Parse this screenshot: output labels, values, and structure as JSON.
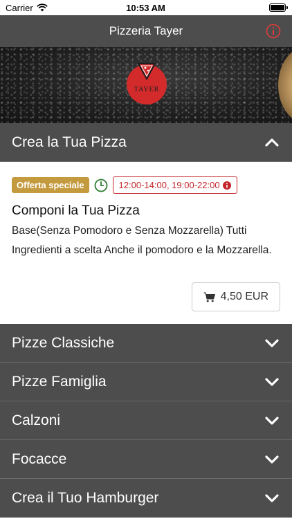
{
  "status_bar": {
    "carrier": "Carrier",
    "time": "10:53 AM"
  },
  "navbar": {
    "title": "Pizzeria Tayer"
  },
  "banner": {
    "logo_text": "TAYER"
  },
  "sections": [
    {
      "title": "Crea la Tua Pizza",
      "expanded": true
    },
    {
      "title": "Pizze Classiche",
      "expanded": false
    },
    {
      "title": "Pizze Famiglia",
      "expanded": false
    },
    {
      "title": "Calzoni",
      "expanded": false
    },
    {
      "title": "Focacce",
      "expanded": false
    },
    {
      "title": "Crea il Tuo Hamburger",
      "expanded": false
    }
  ],
  "item": {
    "badge_offer": "Offerta speciale",
    "hours": "12:00-14:00, 19:00-22:00",
    "title": "Componi la Tua Pizza",
    "description": "Base(Senza Pomodoro e Senza Mozzarella) Tutti Ingredienti a scelta Anche il pomodoro e la Mozza­rella.",
    "price": "4,50 EUR"
  },
  "colors": {
    "header": "#4d4d4d",
    "offer": "#c49a3f",
    "accent_red": "#c4252a",
    "clock_green": "#2e7d32"
  }
}
